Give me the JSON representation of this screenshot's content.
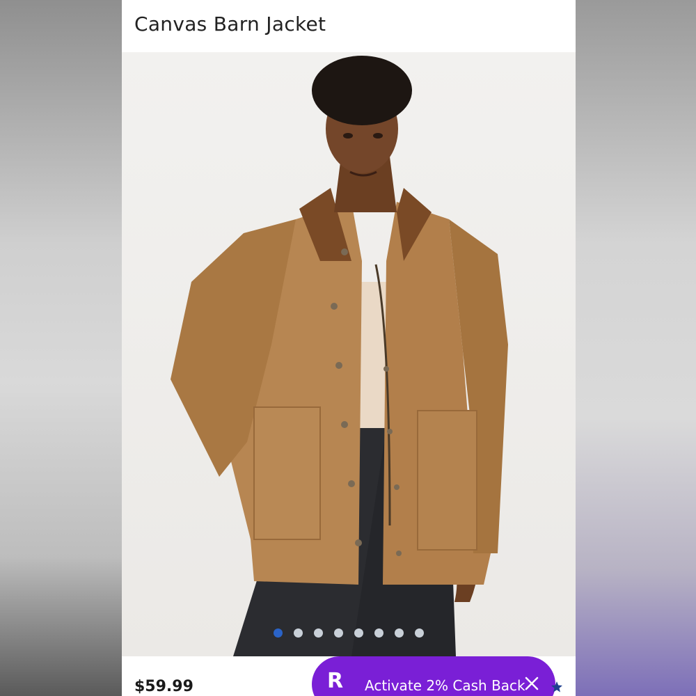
{
  "product": {
    "title": "Canvas Barn Jacket",
    "price": "$59.99"
  },
  "gallery": {
    "image_count": 8,
    "active_index": 0
  },
  "cashback_banner": {
    "logo": "R",
    "label": "Activate 2% Cash Back",
    "close_icon": "close-icon"
  },
  "colors": {
    "accent_purple": "#7a1fd6",
    "active_dot": "#2a63c7",
    "inactive_dot": "#c9d0d8",
    "jacket": "#b78652"
  }
}
